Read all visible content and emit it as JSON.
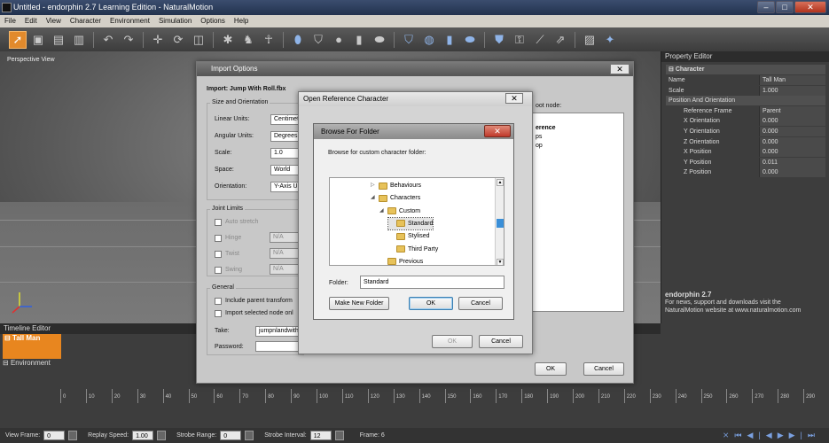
{
  "app": {
    "title": "Untitled - endorphin 2.7 Learning Edition - NaturalMotion",
    "win_buttons": [
      "‒",
      "□",
      "✕"
    ]
  },
  "menu": [
    "File",
    "Edit",
    "View",
    "Character",
    "Environment",
    "Simulation",
    "Options",
    "Help"
  ],
  "viewport": {
    "label": "Perspective View"
  },
  "property_editor": {
    "title": "Property Editor",
    "group": "Character",
    "rows": [
      {
        "k": "Name",
        "v": "Tall Man"
      },
      {
        "k": "Scale",
        "v": "1.000"
      },
      {
        "k": "Position And Orientation",
        "v": "",
        "group": true
      },
      {
        "k": "Reference Frame",
        "v": "Parent"
      },
      {
        "k": "X Orientation",
        "v": "0.000"
      },
      {
        "k": "Y Orientation",
        "v": "0.000"
      },
      {
        "k": "Z Orientation",
        "v": "0.000"
      },
      {
        "k": "X Position",
        "v": "0.000"
      },
      {
        "k": "Y Position",
        "v": "0.011"
      },
      {
        "k": "Z Position",
        "v": "0.000"
      }
    ],
    "info_title": "endorphin 2.7",
    "info_line1": "For news, support and downloads visit the",
    "info_line2": "NaturalMotion website at www.naturalmotion.com"
  },
  "timeline": {
    "title": "Timeline Editor",
    "track1": "Tall Man",
    "track2": "Environment",
    "ticks": [
      "0",
      "10",
      "20",
      "30",
      "40",
      "50",
      "60",
      "70",
      "80",
      "90",
      "100",
      "110",
      "120",
      "130",
      "140",
      "150",
      "160",
      "170",
      "180",
      "190",
      "200",
      "210",
      "220",
      "230",
      "240",
      "250",
      "260",
      "270",
      "280",
      "290"
    ]
  },
  "status": {
    "view_frame_label": "View Frame:",
    "view_frame": "0",
    "replay_label": "Replay Speed:",
    "replay": "1.00",
    "strobe_range_label": "Strobe Range:",
    "strobe_range": "0",
    "strobe_interval_label": "Strobe Interval:",
    "strobe_interval": "12",
    "frame": "Frame: 6"
  },
  "import_dialog": {
    "title": "Import Options",
    "file": "Import: Jump With Roll.fbx",
    "size_group": "Size and Orientation",
    "linear_label": "Linear Units:",
    "linear": "Centimet",
    "angular_label": "Angular Units:",
    "angular": "Degrees",
    "scale_label": "Scale:",
    "scale": "1.0",
    "space_label": "Space:",
    "space": "World",
    "orient_label": "Orientation:",
    "orient": "Y-Axis Up",
    "joint_group": "Joint Limits",
    "auto_stretch": "Auto stretch",
    "hinge": "Hinge",
    "twist": "Twist",
    "swing": "Swing",
    "na": "N/A",
    "general_group": "General",
    "include_parent": "Include parent transform",
    "import_selected": "Import selected node onl",
    "take_label": "Take:",
    "take": "jumpnlandwith",
    "password_label": "Password:",
    "root_node": "oot node:",
    "right_list": [
      "erence",
      "ps",
      "op"
    ],
    "ok": "OK",
    "cancel": "Cancel"
  },
  "ref_dialog": {
    "title": "Open Reference Character",
    "ok": "OK",
    "cancel": "Cancel"
  },
  "browse_dialog": {
    "title": "Browse For Folder",
    "prompt": "Browse for custom character folder:",
    "tree": [
      {
        "label": "Behaviours",
        "indent": 0,
        "exp": "▷"
      },
      {
        "label": "Characters",
        "indent": 0,
        "exp": "◢"
      },
      {
        "label": "Custom",
        "indent": 1,
        "exp": "◢"
      },
      {
        "label": "Standard",
        "indent": 2,
        "exp": "",
        "selected": true
      },
      {
        "label": "Stylised",
        "indent": 2,
        "exp": ""
      },
      {
        "label": "Third Party",
        "indent": 2,
        "exp": ""
      },
      {
        "label": "Previous",
        "indent": 1,
        "exp": ""
      }
    ],
    "folder_label": "Folder:",
    "folder": "Standard",
    "make_new": "Make New Folder",
    "ok": "OK",
    "cancel": "Cancel"
  }
}
